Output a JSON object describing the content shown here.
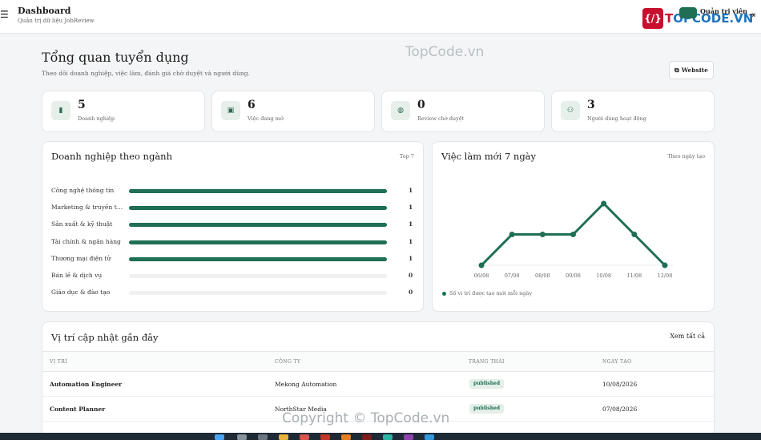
{
  "topbar": {
    "menu_icon": "☰",
    "title": "Dashboard",
    "subtitle": "Quản trị dữ liệu JobReview",
    "logo_badge": "{/}",
    "logo_prefix": "T",
    "logo_main": "OPCODE.VN",
    "admin_label": "Quản trị viên",
    "logout_icon": "⇥"
  },
  "watermarks": {
    "top": "TopCode.vn",
    "bottom": "Copyright © TopCode.vn"
  },
  "header": {
    "title": "Tổng quan tuyển dụng",
    "subtitle": "Theo dõi doanh nghiệp, việc làm, đánh giá chờ duyệt và người dùng.",
    "website_button": "Website",
    "website_icon": "⧉"
  },
  "stats": [
    {
      "icon": "building-icon",
      "glyph": "▮",
      "value": "5",
      "label": "Doanh nghiệp"
    },
    {
      "icon": "briefcase-icon",
      "glyph": "▣",
      "value": "6",
      "label": "Việc đang mở"
    },
    {
      "icon": "chat-icon",
      "glyph": "◍",
      "value": "0",
      "label": "Review chờ duyệt"
    },
    {
      "icon": "users-icon",
      "glyph": "⚇",
      "value": "3",
      "label": "Người dùng hoạt động"
    }
  ],
  "industry_panel": {
    "title": "Doanh nghiệp theo ngành",
    "meta": "Top 7",
    "rows": [
      {
        "label": "Công nghệ thông tin",
        "value": 1,
        "fraction": 1
      },
      {
        "label": "Marketing & truyền thông",
        "value": 1,
        "fraction": 1
      },
      {
        "label": "Sản xuất & kỹ thuật",
        "value": 1,
        "fraction": 1
      },
      {
        "label": "Tài chính & ngân hàng",
        "value": 1,
        "fraction": 1
      },
      {
        "label": "Thương mại điện tử",
        "value": 1,
        "fraction": 1
      },
      {
        "label": "Bán lẻ & dịch vụ",
        "value": 0,
        "fraction": 0
      },
      {
        "label": "Giáo dục & đào tạo",
        "value": 0,
        "fraction": 0
      }
    ]
  },
  "jobs_panel": {
    "title": "Việc làm mới 7 ngày",
    "meta": "Theo ngày tạo",
    "legend": "Số vị trí được tạo mới mỗi ngày"
  },
  "chart_data": {
    "type": "line",
    "title": "Việc làm mới 7 ngày",
    "x": [
      "06/08",
      "07/08",
      "08/08",
      "09/08",
      "10/08",
      "11/08",
      "12/08"
    ],
    "series": [
      {
        "name": "Số vị trí được tạo mới mỗi ngày",
        "values": [
          0,
          1,
          1,
          1,
          2,
          1,
          0
        ]
      }
    ],
    "ylim": [
      0,
      2
    ],
    "grid": false,
    "legend_position": "bottom-left",
    "color": "#1f6f54"
  },
  "recent_panel": {
    "title": "Vị trí cập nhật gần đây",
    "view_all": "Xem tất cả",
    "columns": [
      "VỊ TRÍ",
      "CÔNG TY",
      "TRẠNG THÁI",
      "NGÀY TẠO"
    ],
    "rows": [
      {
        "position": "Automation Engineer",
        "company": "Mekong Automation",
        "status": "published",
        "date": "10/08/2026"
      },
      {
        "position": "Content Planner",
        "company": "NorthStar Media",
        "status": "published",
        "date": "07/08/2026"
      }
    ]
  },
  "colors": {
    "accent": "#1f6f54",
    "accent_light": "#e6efe9",
    "background": "#f4f5f6"
  }
}
